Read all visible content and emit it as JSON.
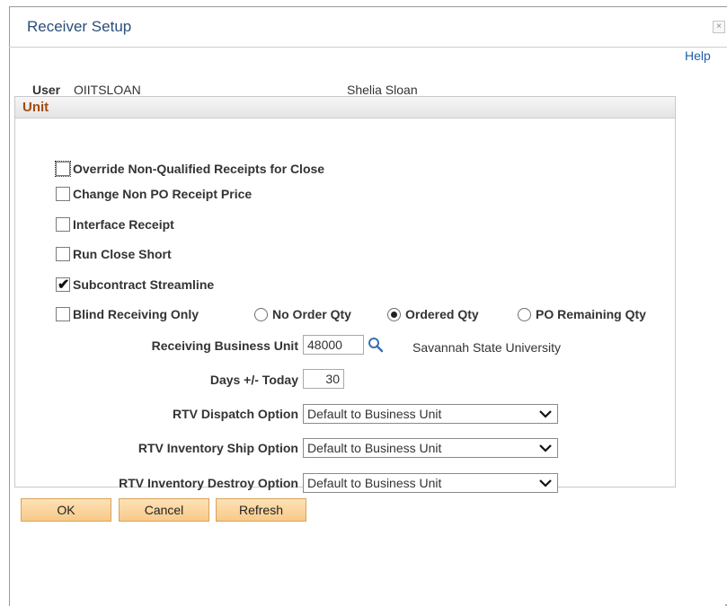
{
  "window": {
    "title": "Receiver Setup",
    "close_glyph": "×",
    "help_label": "Help"
  },
  "user": {
    "label": "User",
    "id": "OIITSLOAN",
    "name": "Shelia Sloan"
  },
  "group": {
    "title": "Unit"
  },
  "checkboxes": [
    {
      "label": "Override Non-Qualified Receipts for Close",
      "checked": false
    },
    {
      "label": "Change Non PO Receipt Price",
      "checked": false
    },
    {
      "label": "Interface Receipt",
      "checked": false
    },
    {
      "label": "Run Close Short",
      "checked": false
    },
    {
      "label": "Subcontract Streamline",
      "checked": true
    },
    {
      "label": "Blind Receiving Only",
      "checked": false
    }
  ],
  "radios": [
    {
      "label": "No Order Qty",
      "selected": false
    },
    {
      "label": "Ordered Qty",
      "selected": true
    },
    {
      "label": "PO Remaining Qty",
      "selected": false
    }
  ],
  "fields": {
    "receiving_bu_label": "Receiving Business Unit",
    "receiving_bu_value": "48000",
    "receiving_bu_desc": "Savannah State University",
    "days_label": "Days +/- Today",
    "days_value": "30",
    "rtv_dispatch_label": "RTV Dispatch Option",
    "rtv_dispatch_value": "Default to Business Unit",
    "rtv_ship_label": "RTV Inventory Ship Option",
    "rtv_ship_value": "Default to Business Unit",
    "rtv_destroy_label": "RTV Inventory Destroy Option",
    "rtv_destroy_value": "Default to Business Unit"
  },
  "buttons": {
    "ok": "OK",
    "cancel": "Cancel",
    "refresh": "Refresh"
  },
  "icons": {
    "lookup": "magnifier-icon",
    "dropdown": "chevron-down-icon",
    "checkmark": "✔"
  },
  "colors": {
    "title": "#2a4f7a",
    "group_title": "#a34a0d",
    "link": "#1f5fa6",
    "button_bg": "#f7c98a"
  }
}
